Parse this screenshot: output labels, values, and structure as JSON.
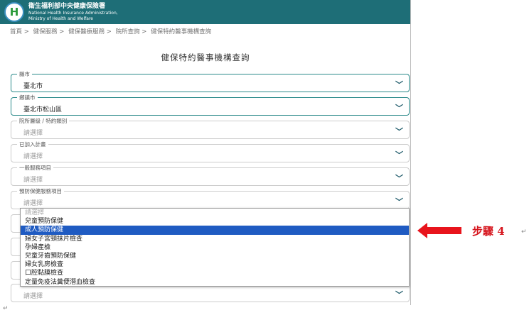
{
  "header": {
    "org_zh": "衛生福利部中央健康保險署",
    "org_en1": "National Health Insurance Administration,",
    "org_en2": "Ministry of Health and Welfare",
    "logo": "H"
  },
  "breadcrumb": [
    "首頁 >",
    "健保服務 >",
    "健保醫療服務 >",
    "院所查詢 >",
    "健保特約醫事機構查詢"
  ],
  "title": "健保特約醫事機構查詢",
  "fields": [
    {
      "label": "縣市",
      "value": "臺北市"
    },
    {
      "label": "鄉鎮市",
      "value": "臺北市松山區"
    },
    {
      "label": "院所層級 / 特約類別",
      "value": "請選擇"
    },
    {
      "label": "已加入計畫",
      "value": "請選擇"
    },
    {
      "label": "一般服務項目",
      "value": "請選擇"
    },
    {
      "label": "預防保健服務項目",
      "value": "請選擇"
    },
    {
      "label": "",
      "value": "請選擇"
    }
  ],
  "dropdown": {
    "options": [
      "請選擇",
      "兒童預防保健",
      "成人預防保健",
      "婦女子宮頸抹片檢查",
      "孕婦產檢",
      "兒童牙齒預防保健",
      "婦女乳房檢查",
      "口腔黏膜檢查",
      "定量免疫法糞便潛血檢查"
    ],
    "selected": "成人預防保健"
  },
  "annotation": {
    "step": "步驟 4",
    "color": "#d6161e"
  },
  "paragraph_mark": "↵"
}
